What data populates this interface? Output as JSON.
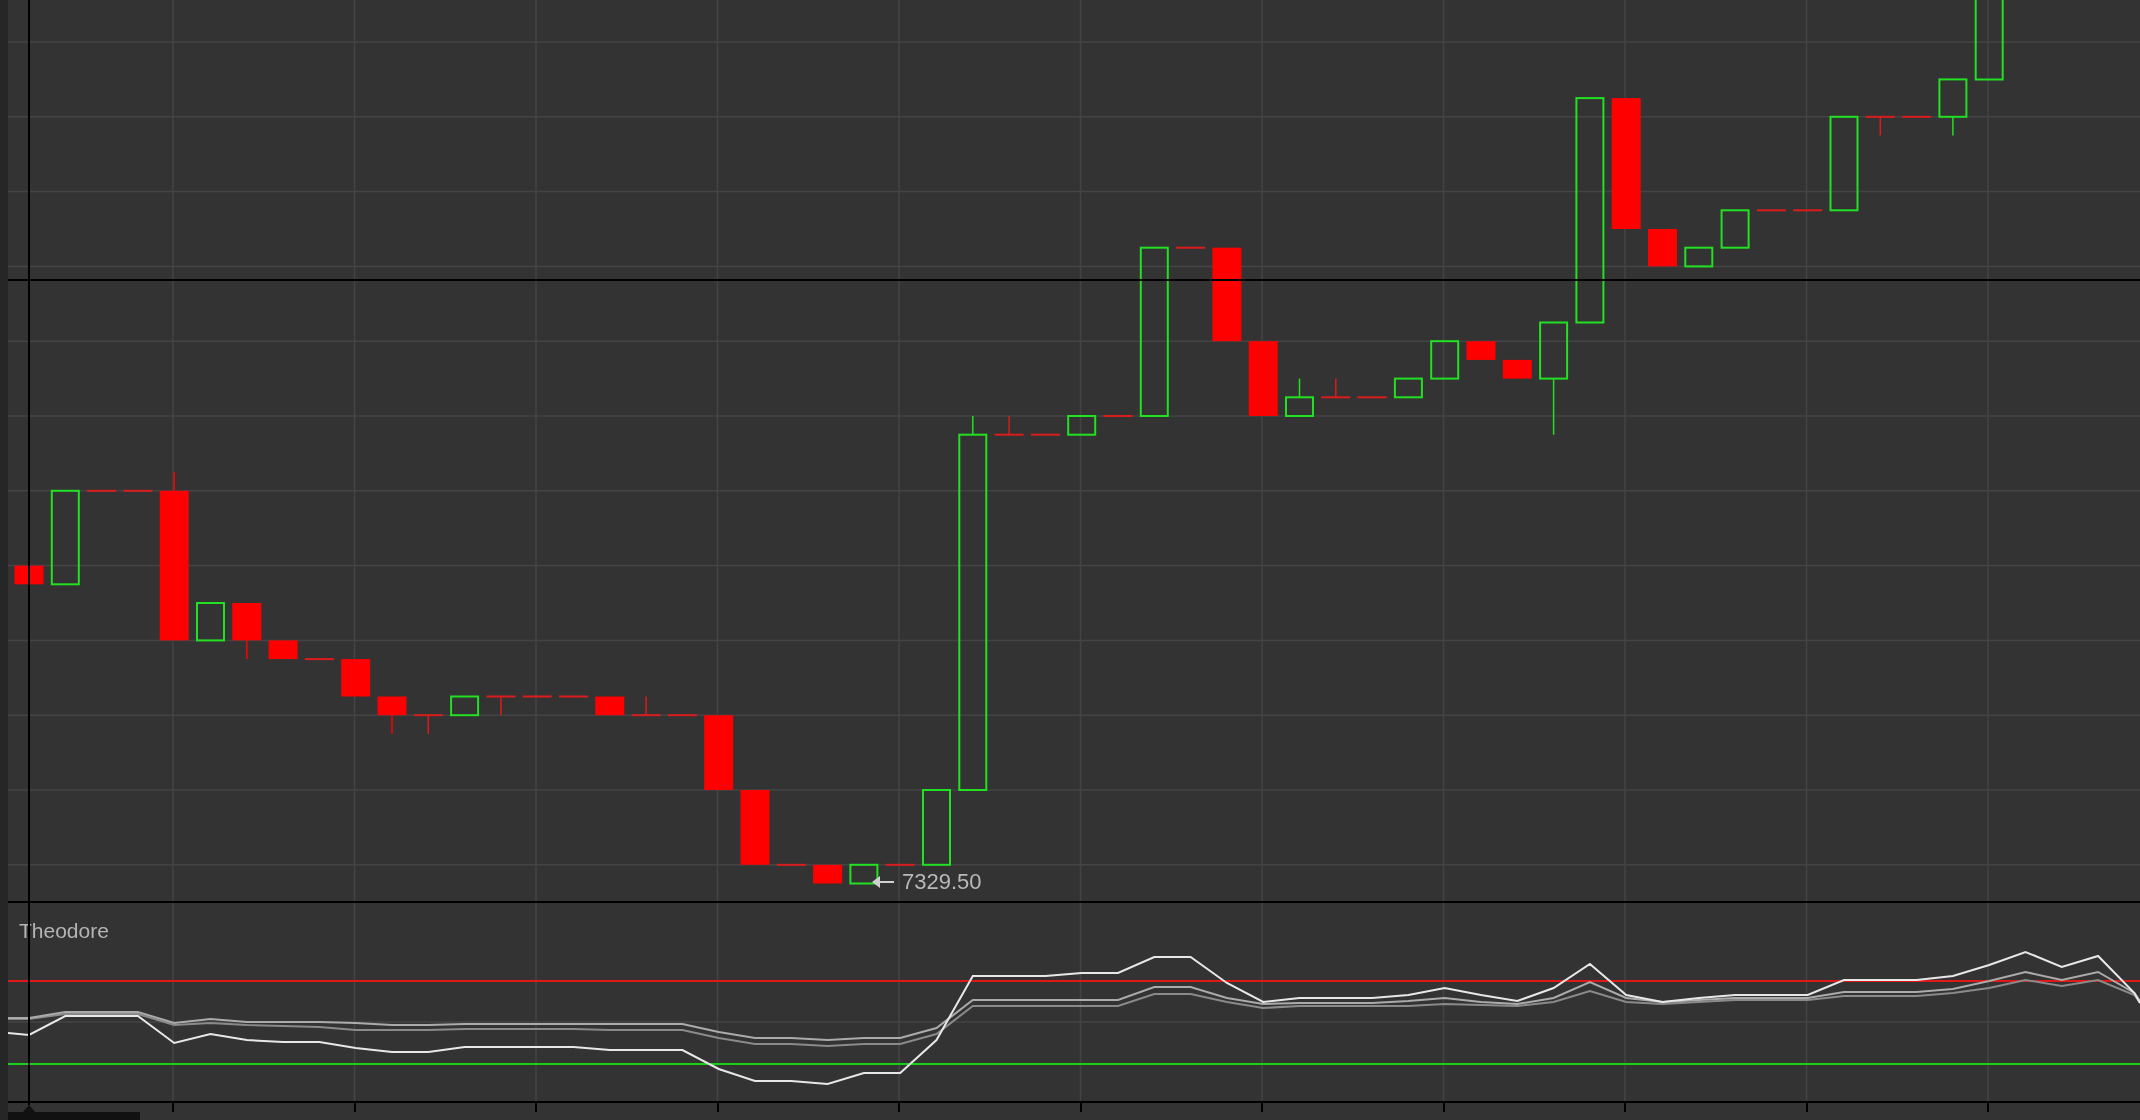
{
  "price_chart": {
    "last_price_label": "7329.50"
  },
  "indicator": {
    "title": "Theodore"
  }
}
